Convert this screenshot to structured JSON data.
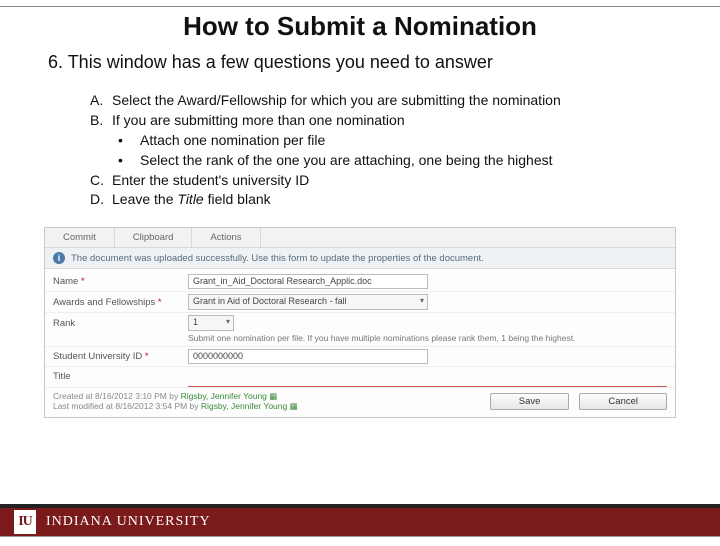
{
  "title": "How to Submit a Nomination",
  "step": "6. This window has a few questions you need to answer",
  "list": {
    "a": "Select the Award/Fellowship for which you are submitting the nomination",
    "b": "If you are submitting more than one nomination",
    "b1": "Attach one nomination per file",
    "b2": "Select the rank of the one you are attaching, one being the highest",
    "c": "Enter the student's university ID",
    "d_prefix": "Leave the ",
    "d_italic": "Title",
    "d_suffix": " field blank"
  },
  "form": {
    "tabs": {
      "commit": "Commit",
      "clipboard": "Clipboard",
      "actions": "Actions"
    },
    "banner": "The document was uploaded successfully. Use this form to update the properties of the document.",
    "labels": {
      "name": "Name",
      "awards": "Awards and Fellowships",
      "rank": "Rank",
      "student_id": "Student University ID",
      "title": "Title"
    },
    "required_marker": "*",
    "values": {
      "name": "Grant_in_Aid_Doctoral Research_Applic.doc",
      "awards": "Grant in Aid of Doctoral Research - fall",
      "rank": "1",
      "student_id": "0000000000",
      "title": ""
    },
    "rank_hint": "Submit one nomination per file. If you have multiple nominations please rank them, 1 being the highest.",
    "meta": {
      "created_prefix": "Created at 8/16/2012 3:10 PM by ",
      "modified_prefix": "Last modified at 8/16/2012 3:54 PM by ",
      "user": "Rigsby, Jennifer Young"
    },
    "buttons": {
      "save": "Save",
      "cancel": "Cancel"
    }
  },
  "footer": {
    "logo": "IU",
    "name": "INDIANA UNIVERSITY"
  }
}
